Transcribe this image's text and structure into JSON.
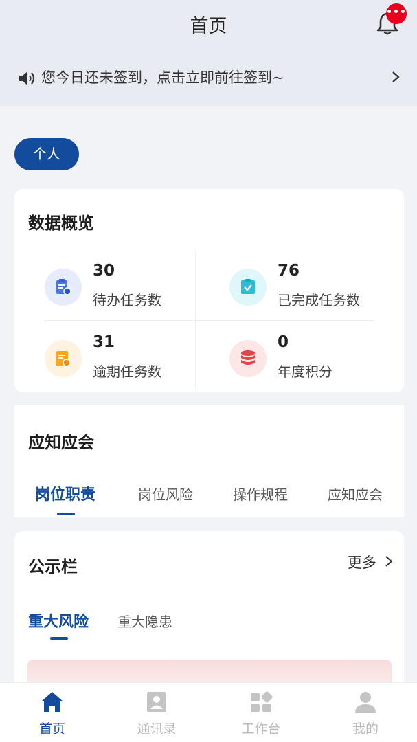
{
  "header": {
    "title": "首页",
    "badge": "•••"
  },
  "notice": {
    "text": "您今日还未签到，点击立即前往签到~"
  },
  "scope_button": "个人",
  "overview": {
    "title": "数据概览",
    "stats": [
      {
        "value": "30",
        "label": "待办任务数",
        "icon": "todo-clipboard-icon",
        "color": "#4a74e8"
      },
      {
        "value": "76",
        "label": "已完成任务数",
        "icon": "done-clipboard-icon",
        "color": "#2bbcd6"
      },
      {
        "value": "31",
        "label": "逾期任务数",
        "icon": "overdue-doc-icon",
        "color": "#f5a623"
      },
      {
        "value": "0",
        "label": "年度积分",
        "icon": "coin-stack-icon",
        "color": "#e8434a"
      }
    ]
  },
  "knowledge": {
    "title": "应知应会",
    "tabs": [
      "岗位职责",
      "岗位风险",
      "操作规程",
      "应知应会"
    ]
  },
  "bulletin": {
    "title": "公示栏",
    "more": "更多",
    "tabs": [
      "重大风险",
      "重大隐患"
    ]
  },
  "tabbar": {
    "items": [
      {
        "label": "首页",
        "icon": "home-icon"
      },
      {
        "label": "通讯录",
        "icon": "contacts-icon"
      },
      {
        "label": "工作台",
        "icon": "workbench-icon"
      },
      {
        "label": "我的",
        "icon": "profile-icon"
      }
    ]
  },
  "colors": {
    "primary": "#134c9c",
    "badge": "#e8001c"
  }
}
